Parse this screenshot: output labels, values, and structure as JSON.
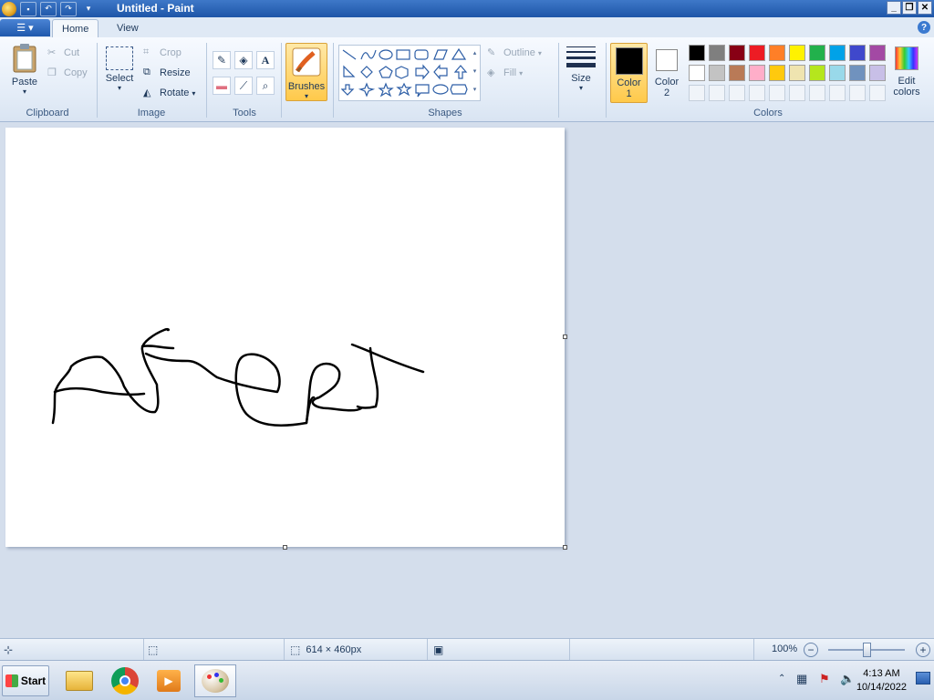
{
  "window": {
    "title": "Untitled - Paint",
    "controls": {
      "minimize": "_",
      "restore": "❐",
      "close": "✕"
    }
  },
  "tabs": [
    {
      "label": "Home"
    },
    {
      "label": "View"
    }
  ],
  "ribbon": {
    "clipboard": {
      "label": "Clipboard",
      "paste": "Paste",
      "cut": "Cut",
      "copy": "Copy"
    },
    "image": {
      "label": "Image",
      "select": "Select",
      "crop": "Crop",
      "resize": "Resize",
      "rotate": "Rotate"
    },
    "tools": {
      "label": "Tools"
    },
    "brushes": {
      "label": "Brushes"
    },
    "shapes": {
      "label": "Shapes",
      "outline": "Outline",
      "fill": "Fill"
    },
    "size": {
      "label": "Size"
    },
    "colors": {
      "label": "Colors",
      "color1_line1": "Color",
      "color1_line2": "1",
      "color2_line1": "Color",
      "color2_line2": "2",
      "edit_line1": "Edit",
      "edit_line2": "colors",
      "color1_value": "#000000",
      "color2_value": "#ffffff",
      "palette_row1": [
        "#000000",
        "#7f7f7f",
        "#880015",
        "#ed1c24",
        "#ff7f27",
        "#fff200",
        "#22b14c",
        "#00a2e8",
        "#3f48cc",
        "#a349a4"
      ],
      "palette_row2": [
        "#ffffff",
        "#c3c3c3",
        "#b97a57",
        "#ffaec9",
        "#ffc90e",
        "#efe4b0",
        "#b5e61d",
        "#99d9ea",
        "#7092be",
        "#c8bfe7"
      ]
    }
  },
  "status": {
    "dimensions": "614 × 460px",
    "zoom": "100%"
  },
  "taskbar": {
    "start": "Start",
    "time": "4:13 AM",
    "date": "10/14/2022"
  }
}
